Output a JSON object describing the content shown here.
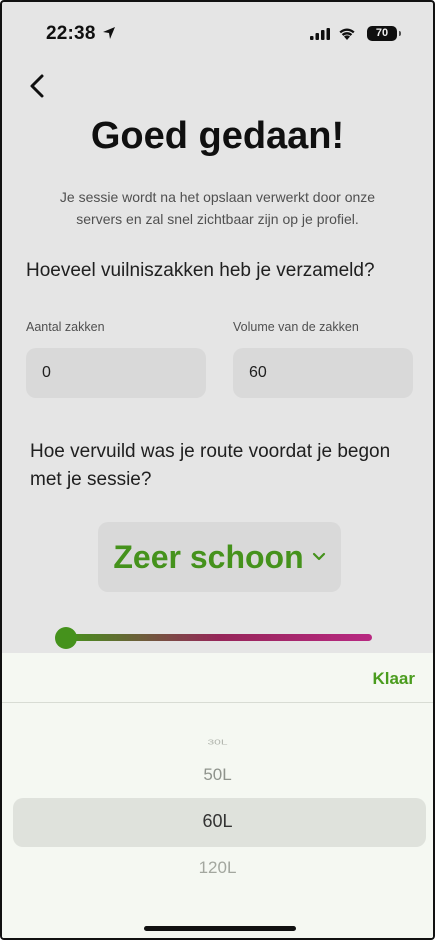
{
  "status_bar": {
    "time": "22:38",
    "battery": "70"
  },
  "header": {
    "title": "Goed gedaan!",
    "subtitle": "Je sessie wordt na het opslaan verwerkt door onze servers en zal snel zichtbaar zijn op je profiel."
  },
  "bags": {
    "question": "Hoeveel vuilniszakken heb je verzameld?",
    "count_label": "Aantal zakken",
    "count_value": "0",
    "volume_label": "Volume van de zakken",
    "volume_value": "60"
  },
  "pollution": {
    "question": "Hoe vervuild was je route voordat je begon met je sessie?",
    "selected": "Zeer schoon",
    "slider_value": 0
  },
  "picker": {
    "done_label": "Klaar",
    "options": [
      "30L",
      "50L",
      "60L",
      "120L"
    ],
    "selected": "60L"
  },
  "colors": {
    "accent": "#4a9c1e",
    "slider_end": "#c42b8a"
  }
}
